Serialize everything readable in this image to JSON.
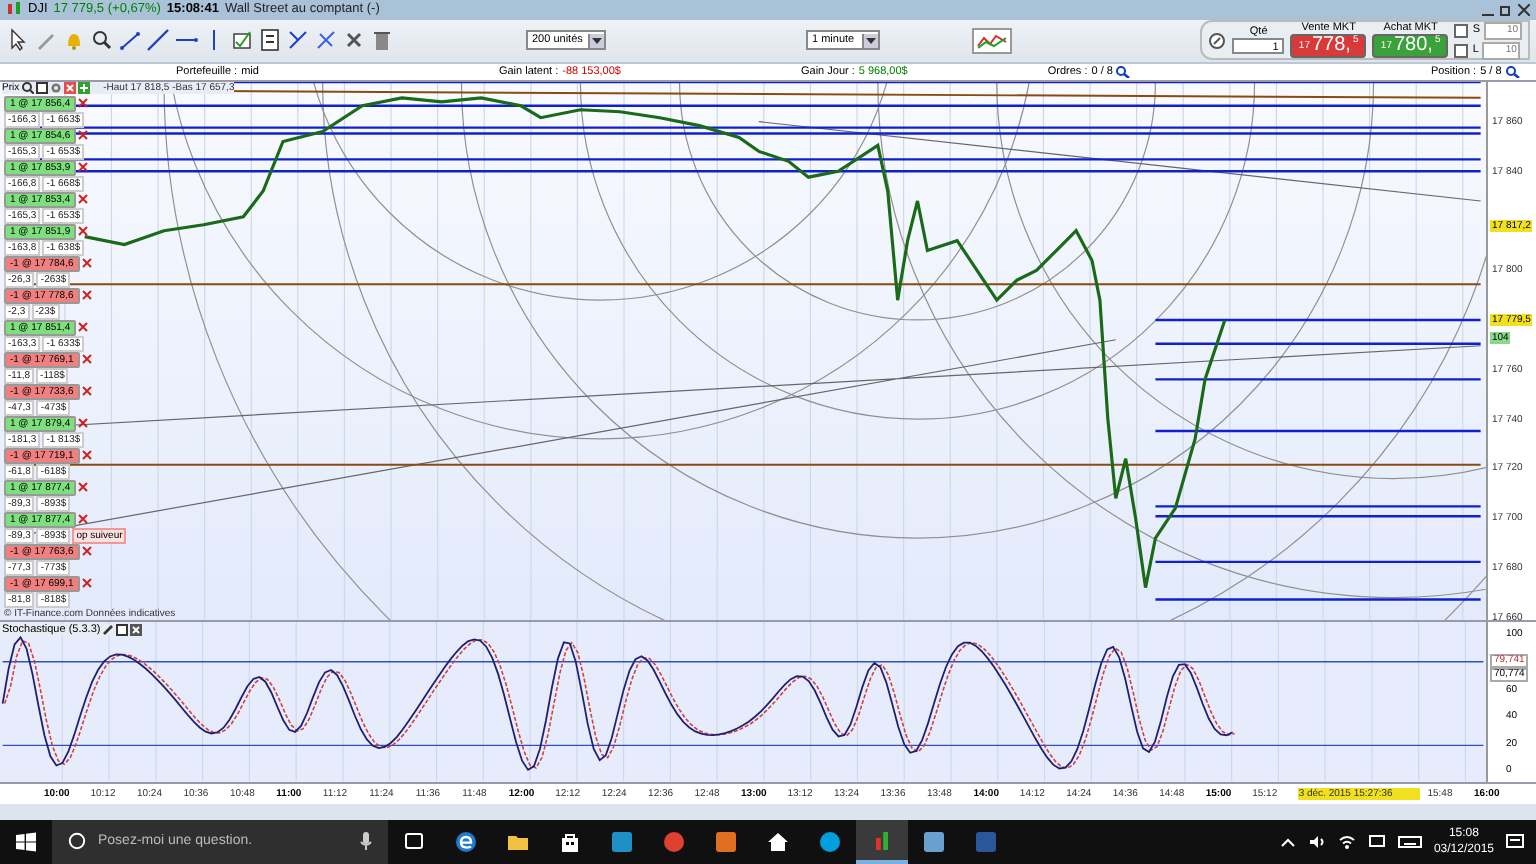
{
  "window": {
    "symbol": "DJI",
    "quote": "17 779,5 (+0,67%)",
    "time": "15:08:41",
    "title": "Wall Street au comptant (-)"
  },
  "toolbar": {
    "units": "200 unités",
    "interval": "1 minute",
    "qty_label": "Qté",
    "qty": "1",
    "sell": {
      "label": "Vente MKT",
      "big_figure": "17",
      "pips": "778,",
      "fraction": "5"
    },
    "buy": {
      "label": "Achat MKT",
      "big_figure": "17",
      "pips": "780,",
      "fraction": "5"
    },
    "stop": {
      "label": "S",
      "checked": false,
      "value": "10"
    },
    "limit": {
      "label": "L",
      "checked": false,
      "value": "10"
    }
  },
  "info": {
    "portfolio_label": "Portefeuille :",
    "portfolio": "mid",
    "latent_label": "Gain latent :",
    "latent": "-88 153,00$",
    "day_label": "Gain Jour :",
    "day": "5 968,00$",
    "orders_label": "Ordres :",
    "orders": "0 / 8",
    "position_label": "Position :",
    "position": "5 / 8"
  },
  "chart": {
    "title": "Prix",
    "header": "-Haut 17 818,5 -Bas 17 657,3",
    "credit": "© IT-Finance.com  Données indicatives",
    "price_ticks": [
      "17 860",
      "17 840",
      "17 800",
      "17 760",
      "17 740",
      "17 720",
      "17 700",
      "17 680",
      "17 660"
    ],
    "badges": [
      {
        "kind": "level",
        "text": "17 817,2"
      },
      {
        "kind": "last",
        "text": "17 779,5"
      },
      {
        "kind": "volume",
        "text": "104"
      }
    ],
    "orders": [
      {
        "kind": "buy",
        "label": "1 @ 17 856,4",
        "points": "-166,3",
        "amount": "-1 663$"
      },
      {
        "kind": "buy",
        "label": "1 @ 17 854,6",
        "points": "-165,3",
        "amount": "-1 653$"
      },
      {
        "kind": "buy",
        "label": "1 @ 17 853,9",
        "points": "-166,8",
        "amount": "-1 668$"
      },
      {
        "kind": "buy",
        "label": "1 @ 17 853,4",
        "points": "-165,3",
        "amount": "-1 653$"
      },
      {
        "kind": "buy",
        "label": "1 @ 17 851,9",
        "points": "-163,8",
        "amount": "-1 638$"
      },
      {
        "kind": "sell",
        "label": "-1 @ 17 784,6",
        "points": "-26,3",
        "amount": "-263$"
      },
      {
        "kind": "sell",
        "label": "-1 @ 17 778,6",
        "points": "-2,3",
        "amount": "-23$"
      },
      {
        "kind": "buy",
        "label": "1 @ 17 851,4",
        "points": "-163,3",
        "amount": "-1 633$"
      },
      {
        "kind": "sell",
        "label": "-1 @ 17 769,1",
        "points": "-11,8",
        "amount": "-118$"
      },
      {
        "kind": "sell",
        "label": "-1 @ 17 733,6",
        "points": "-47,3",
        "amount": "-473$"
      },
      {
        "kind": "buy",
        "label": "1 @ 17 879,4",
        "points": "-181,3",
        "amount": "-1 813$"
      },
      {
        "kind": "sell",
        "label": "-1 @ 17 719,1",
        "points": "-61,8",
        "amount": "-618$"
      },
      {
        "kind": "buy",
        "label": "1 @ 17 877,4",
        "points": "-89,3",
        "amount": "-893$"
      },
      {
        "kind": "buy",
        "label": "1 @ 17 877,4",
        "points": "-89,3",
        "amount": "-893$",
        "note": "op suiveur"
      },
      {
        "kind": "sell",
        "label": "-1 @ 17 763,6",
        "points": "-77,3",
        "amount": "-773$"
      },
      {
        "kind": "sell",
        "label": "-1 @ 17 699,1",
        "points": "-81,8",
        "amount": "-818$"
      }
    ]
  },
  "stochastic": {
    "title": "Stochastique (5.3.3)",
    "ticks": [
      "100",
      "60",
      "40",
      "20",
      "0"
    ],
    "badges": [
      {
        "kind": "k",
        "text": "79,741"
      },
      {
        "kind": "d",
        "text": "70,774"
      }
    ]
  },
  "time_axis": {
    "labels": [
      {
        "kind": "time",
        "text": "10:00",
        "major": true
      },
      {
        "kind": "time",
        "text": "10:12",
        "major": false
      },
      {
        "kind": "time",
        "text": "10:24",
        "major": false
      },
      {
        "kind": "time",
        "text": "10:36",
        "major": false
      },
      {
        "kind": "time",
        "text": "10:48",
        "major": false
      },
      {
        "kind": "time",
        "text": "11:00",
        "major": true
      },
      {
        "kind": "time",
        "text": "11:12",
        "major": false
      },
      {
        "kind": "time",
        "text": "11:24",
        "major": false
      },
      {
        "kind": "time",
        "text": "11:36",
        "major": false
      },
      {
        "kind": "time",
        "text": "11:48",
        "major": false
      },
      {
        "kind": "time",
        "text": "12:00",
        "major": true
      },
      {
        "kind": "time",
        "text": "12:12",
        "major": false
      },
      {
        "kind": "time",
        "text": "12:24",
        "major": false
      },
      {
        "kind": "time",
        "text": "12:36",
        "major": false
      },
      {
        "kind": "time",
        "text": "12:48",
        "major": false
      },
      {
        "kind": "time",
        "text": "13:00",
        "major": true
      },
      {
        "kind": "time",
        "text": "13:12",
        "major": false
      },
      {
        "kind": "time",
        "text": "13:24",
        "major": false
      },
      {
        "kind": "time",
        "text": "13:36",
        "major": false
      },
      {
        "kind": "time",
        "text": "13:48",
        "major": false
      },
      {
        "kind": "time",
        "text": "14:00",
        "major": true
      },
      {
        "kind": "time",
        "text": "14:12",
        "major": false
      },
      {
        "kind": "time",
        "text": "14:24",
        "major": false
      },
      {
        "kind": "time",
        "text": "14:36",
        "major": false
      },
      {
        "kind": "time",
        "text": "14:48",
        "major": false
      },
      {
        "kind": "time",
        "text": "15:00",
        "major": true
      },
      {
        "kind": "time",
        "text": "15:12",
        "major": false
      },
      {
        "kind": "cursor",
        "text": "3 déc. 2015 15:27:36",
        "major": false
      },
      {
        "kind": "time",
        "text": "15:48",
        "major": false
      },
      {
        "kind": "time",
        "text": "16:00",
        "major": true
      }
    ]
  },
  "taskbar": {
    "search_placeholder": "Posez-moi une question.",
    "time": "15:08",
    "date": "03/12/2015",
    "apps": [
      {
        "kind": "edge",
        "active": false
      },
      {
        "kind": "folder",
        "active": false
      },
      {
        "kind": "store",
        "active": false
      },
      {
        "kind": "square",
        "color": "#1e90c8",
        "active": false
      },
      {
        "kind": "circle",
        "color": "#e04030",
        "active": false
      },
      {
        "kind": "square",
        "color": "#e07020",
        "active": false
      },
      {
        "kind": "home",
        "active": false
      },
      {
        "kind": "circle",
        "color": "#00a0e0",
        "active": false
      },
      {
        "kind": "bars",
        "active": true
      },
      {
        "kind": "square",
        "color": "#6aa0d0",
        "active": false
      },
      {
        "kind": "square",
        "color": "#2b579a",
        "active": false
      }
    ]
  }
}
